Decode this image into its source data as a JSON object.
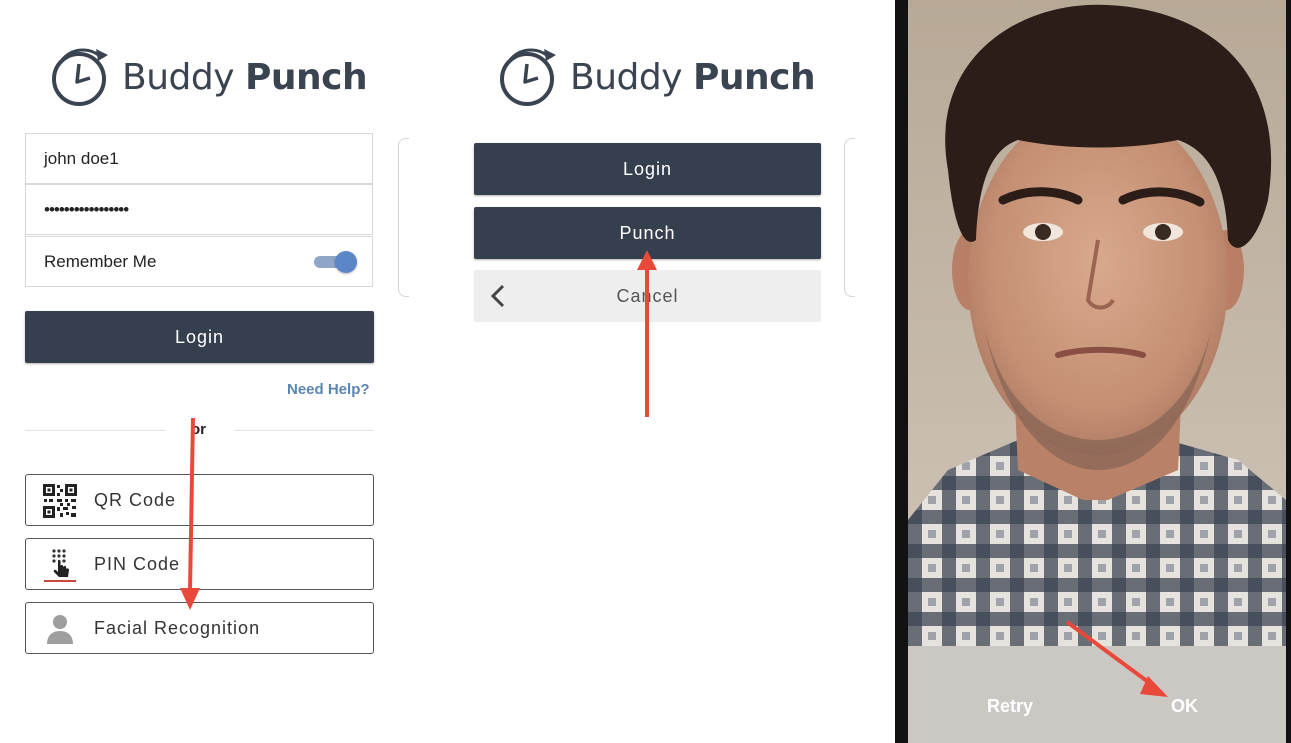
{
  "logo": {
    "brand_light": "Buddy",
    "brand_bold": "Punch"
  },
  "login_form": {
    "username_value": "john doe1",
    "password_value": "•••••••••••••••••",
    "remember_label": "Remember Me",
    "remember_on": true,
    "login_label": "Login",
    "help_link": "Need Help?",
    "or_label": "or"
  },
  "login_options": [
    {
      "label": "QR Code",
      "icon": "qr-code-icon"
    },
    {
      "label": "PIN Code",
      "icon": "pin-keypad-icon"
    },
    {
      "label": "Facial Recognition",
      "icon": "person-icon"
    }
  ],
  "action_panel": {
    "login_label": "Login",
    "punch_label": "Punch",
    "cancel_label": "Cancel"
  },
  "camera_panel": {
    "retry_label": "Retry",
    "ok_label": "OK"
  },
  "colors": {
    "dark_button": "#353f4d",
    "link": "#5b85b4",
    "arrow": "#e8493a",
    "toggle": "#5b87c9"
  }
}
